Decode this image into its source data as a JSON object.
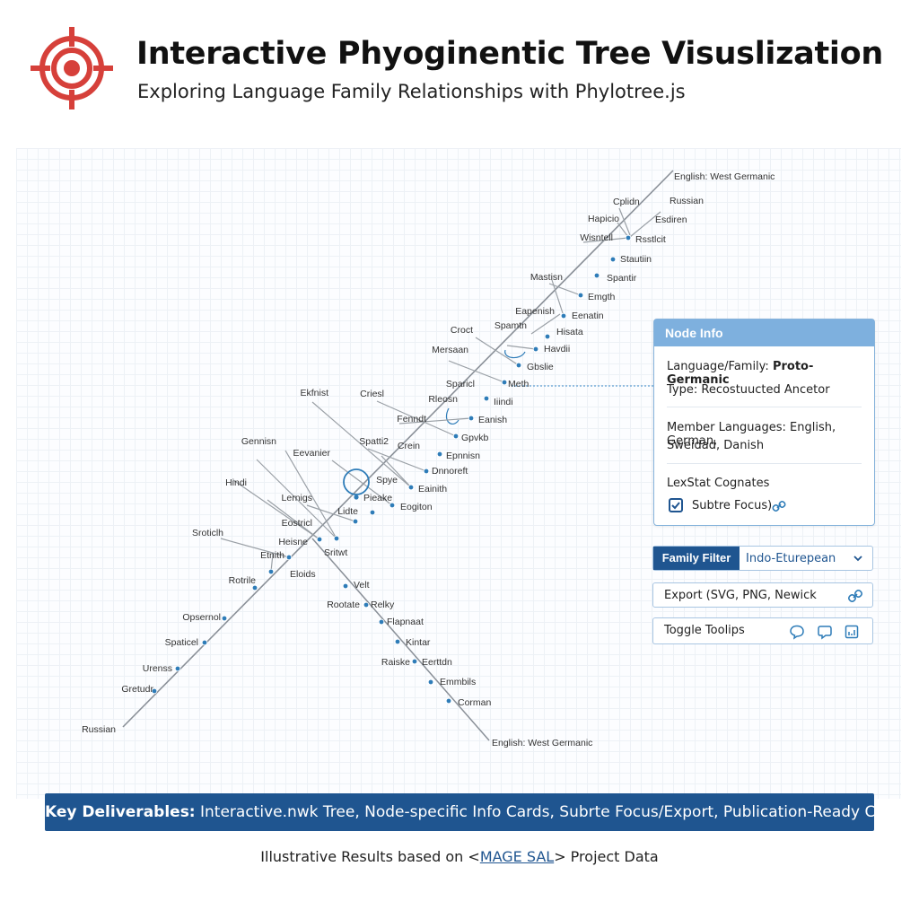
{
  "header": {
    "logo_icon": "target-icon",
    "title": "Interactive Phyoginentic Tree Visuslization",
    "subtitle": "Exploring Language Family Relationships with Phylotree.js"
  },
  "tree": {
    "main_branch_labels": [
      {
        "text": "English: West Germanic"
      },
      {
        "text": "Russian"
      },
      {
        "text": "Cplidn"
      },
      {
        "text": "Esdiren"
      },
      {
        "text": "Hapicio"
      },
      {
        "text": "Wisntell"
      },
      {
        "text": "Rsstlcit"
      },
      {
        "text": "Stautiin"
      },
      {
        "text": "Spantir"
      },
      {
        "text": "Mastisn"
      },
      {
        "text": "Emgth"
      },
      {
        "text": "Eapenish"
      },
      {
        "text": "Eenatin"
      },
      {
        "text": "Spamtn"
      },
      {
        "text": "Hisata"
      },
      {
        "text": "Croct"
      },
      {
        "text": "Havdii"
      },
      {
        "text": "Mersaan"
      },
      {
        "text": "Gbslie"
      },
      {
        "text": "Sparicl"
      },
      {
        "text": "Meth"
      },
      {
        "text": "Ekfnist"
      },
      {
        "text": "Criesl"
      },
      {
        "text": "Iiindi"
      },
      {
        "text": "Rleosn"
      },
      {
        "text": "Fenndt"
      },
      {
        "text": "Eanish"
      },
      {
        "text": "Gennisn"
      },
      {
        "text": "Spatti2"
      },
      {
        "text": "Gpvkb"
      },
      {
        "text": "Eevanier"
      },
      {
        "text": "Crein"
      },
      {
        "text": "Epnnisn"
      },
      {
        "text": "Hindi"
      },
      {
        "text": "Spye"
      },
      {
        "text": "Dnnoreft"
      },
      {
        "text": "Pieake"
      },
      {
        "text": "Eainith"
      },
      {
        "text": "Lernigs"
      },
      {
        "text": "Lidte"
      },
      {
        "text": "Eogiton"
      },
      {
        "text": "Eostricl"
      },
      {
        "text": "Sroticlh"
      },
      {
        "text": "Heisne"
      },
      {
        "text": "Sritwt"
      },
      {
        "text": "Etnith"
      },
      {
        "text": "Eloids"
      },
      {
        "text": "Rotrile"
      },
      {
        "text": "Opsernol"
      },
      {
        "text": "Spaticel"
      },
      {
        "text": "Urenss"
      },
      {
        "text": "Gretudr"
      },
      {
        "text": "Russian"
      }
    ],
    "lower_branch_labels": [
      {
        "text": "Velt"
      },
      {
        "text": "Rootate"
      },
      {
        "text": "Relky"
      },
      {
        "text": "Flapnaat"
      },
      {
        "text": "Kintar"
      },
      {
        "text": "Raiske"
      },
      {
        "text": "Eerttdn"
      },
      {
        "text": "Emmbils"
      },
      {
        "text": "Corman"
      },
      {
        "text": "English: West Germanic"
      }
    ]
  },
  "node_info": {
    "header": "Node Info",
    "language_label": "Language/Family:",
    "language_value": "Proto-Germanic",
    "type_text": "Type: Recostuucted Ancetor",
    "members_line1": "Member Languages: English, German,",
    "members_line2": "Sweidad, Danish",
    "lexstat": "LexStat Cognates",
    "subtree_focus": "Subtre Focus)",
    "check_icon": "checkbox-icon",
    "link_icon": "link-icon"
  },
  "controls": {
    "family_filter_label": "Family Filter",
    "family_filter_value": "Indo-Eturepean",
    "export_label": "Export (SVG, PNG, Newick",
    "toggle_label": "Toggle Toolips"
  },
  "banner": {
    "bold": "Key Deliverables:",
    "rest": " Interactive.nwk Tree, Node-specific Info Cards, Subrte Focus/Export, Publication-Ready Charts"
  },
  "footer": {
    "before": "Illustrative Results based on <",
    "link": "MAGE SAL",
    "after": "> Project Data"
  },
  "colors": {
    "accent": "#1f5590",
    "node_header": "#7eb0de",
    "branch": "#8a9098",
    "node": "#2e7cb8",
    "logo_red": "#d6403a"
  }
}
